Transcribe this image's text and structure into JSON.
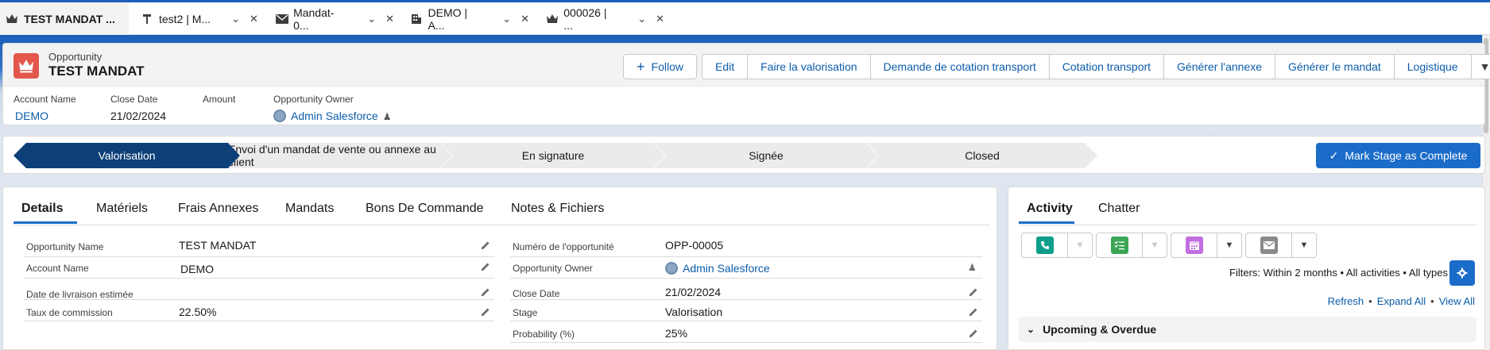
{
  "workspace_tabs": [
    {
      "label": "TEST MANDAT ...",
      "icon": "crown-icon",
      "active": true
    },
    {
      "label": "test2 | M...",
      "icon": "tool-icon",
      "active": false
    },
    {
      "label": "Mandat-0...",
      "icon": "envelope-icon",
      "active": false
    },
    {
      "label": "DEMO | A...",
      "icon": "building-icon",
      "active": false
    },
    {
      "label": "000026 | ...",
      "icon": "crown-icon",
      "active": false
    }
  ],
  "record": {
    "object_type": "Opportunity",
    "title": "TEST MANDAT",
    "icon": "crown-icon",
    "icon_color": "#e3574d"
  },
  "actions": {
    "follow": "Follow",
    "buttons": [
      "Edit",
      "Faire la valorisation",
      "Demande de cotation transport",
      "Cotation transport",
      "Générer l'annexe",
      "Générer le mandat",
      "Logistique"
    ]
  },
  "highlights": {
    "account_label": "Account Name",
    "account_value": "DEMO",
    "close_label": "Close Date",
    "close_value": "21/02/2024",
    "amount_label": "Amount",
    "owner_label": "Opportunity Owner",
    "owner_value": "Admin Salesforce"
  },
  "path": {
    "steps": [
      "Valorisation",
      "Envoi d'un mandat de vente ou annexe au client",
      "En signature",
      "Signée",
      "Closed"
    ],
    "current_index": 0,
    "mark_complete": "Mark Stage as Complete"
  },
  "detail_tabs": [
    "Details",
    "Matériels",
    "Frais Annexes",
    "Mandats",
    "Bons De Commande",
    "Notes & Fichiers"
  ],
  "fields_left": [
    {
      "label": "Opportunity Name",
      "value": "TEST MANDAT",
      "link": false
    },
    {
      "label": "Account Name",
      "value": "DEMO",
      "link": true
    },
    {
      "label": "Date de livraison estimée",
      "value": "",
      "link": false
    },
    {
      "label": "Taux de commission",
      "value": "22.50%",
      "link": false
    }
  ],
  "fields_right": [
    {
      "label": "Numéro de l'opportunité",
      "value": "OPP-00005",
      "link": false
    },
    {
      "label": "Opportunity Owner",
      "value": "Admin Salesforce",
      "link": true
    },
    {
      "label": "Close Date",
      "value": "21/02/2024",
      "link": false
    },
    {
      "label": "Stage",
      "value": "Valorisation",
      "link": false
    },
    {
      "label": "Probability (%)",
      "value": "25%",
      "link": false
    }
  ],
  "activity": {
    "tabs": [
      "Activity",
      "Chatter"
    ],
    "publishers": [
      {
        "icon": "phone-icon",
        "color": "#0b9e8a",
        "dropdown_enabled": false
      },
      {
        "icon": "task-icon",
        "color": "#3ba755",
        "dropdown_enabled": false
      },
      {
        "icon": "calendar-icon",
        "color": "#c16ee0",
        "dropdown_enabled": true
      },
      {
        "icon": "email-icon",
        "color": "#8a8a8a",
        "dropdown_enabled": true
      }
    ],
    "filters": "Filters: Within 2 months • All activities • All types",
    "links": [
      "Refresh",
      "Expand All",
      "View All"
    ],
    "upcoming": "Upcoming & Overdue"
  }
}
